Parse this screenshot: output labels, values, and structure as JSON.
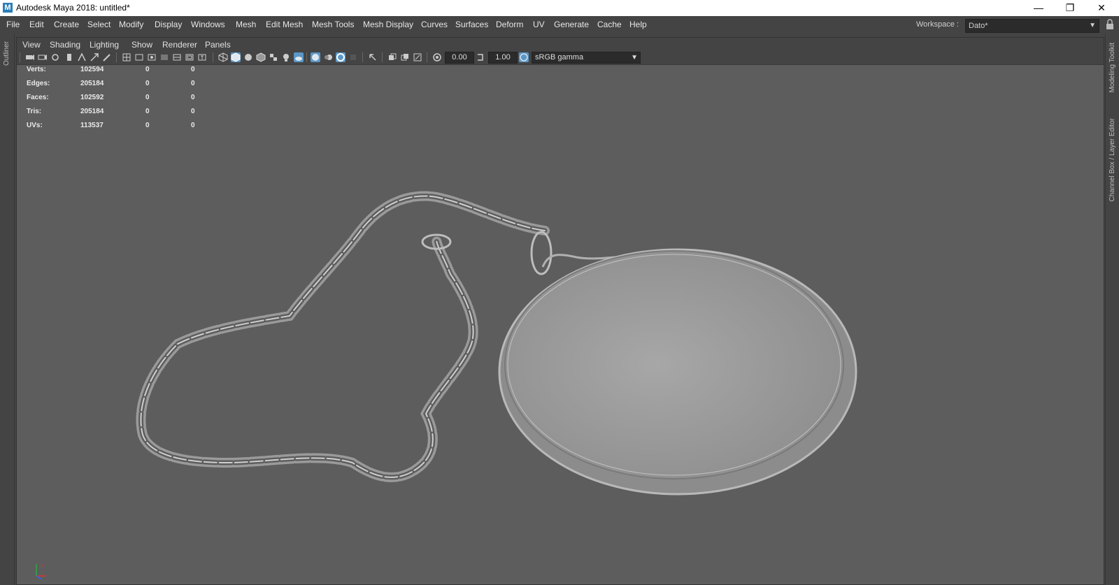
{
  "window": {
    "title": "Autodesk Maya 2018: untitled*",
    "logo_letter": "M",
    "controls": {
      "minimize": "—",
      "restore": "❐",
      "close": "✕"
    }
  },
  "menubar": {
    "items": [
      "File",
      "Edit",
      "Create",
      "Select",
      "Modify",
      "Display",
      "Windows",
      "Mesh",
      "Edit Mesh",
      "Mesh Tools",
      "Mesh Display",
      "Curves",
      "Surfaces",
      "Deform",
      "UV",
      "Generate",
      "Cache",
      "Help"
    ]
  },
  "workspace": {
    "label": "Workspace :",
    "value": "Dato*"
  },
  "side_tabs": {
    "left": "Outliner",
    "right_top": "Modeling Toolkit",
    "right_bottom": "Channel Box / Layer Editor"
  },
  "panel": {
    "menu": [
      "View",
      "Shading",
      "Lighting",
      "Show",
      "Renderer",
      "Panels"
    ],
    "toolbar": {
      "exposure": "0.00",
      "gamma_value": "1.00",
      "color_space": "sRGB gamma"
    }
  },
  "hud": {
    "rows": [
      {
        "label": "Verts:",
        "total": "102594",
        "selected": "0",
        "component": "0"
      },
      {
        "label": "Edges:",
        "total": "205184",
        "selected": "0",
        "component": "0"
      },
      {
        "label": "Faces:",
        "total": "102592",
        "selected": "0",
        "component": "0"
      },
      {
        "label": "Tris:",
        "total": "205184",
        "selected": "0",
        "component": "0"
      },
      {
        "label": "UVs:",
        "total": "113537",
        "selected": "0",
        "component": "0"
      }
    ]
  },
  "colors": {
    "viewport_bg": "#5d5d5d",
    "ui_bg": "#444444",
    "highlight": "#5c97c6"
  }
}
